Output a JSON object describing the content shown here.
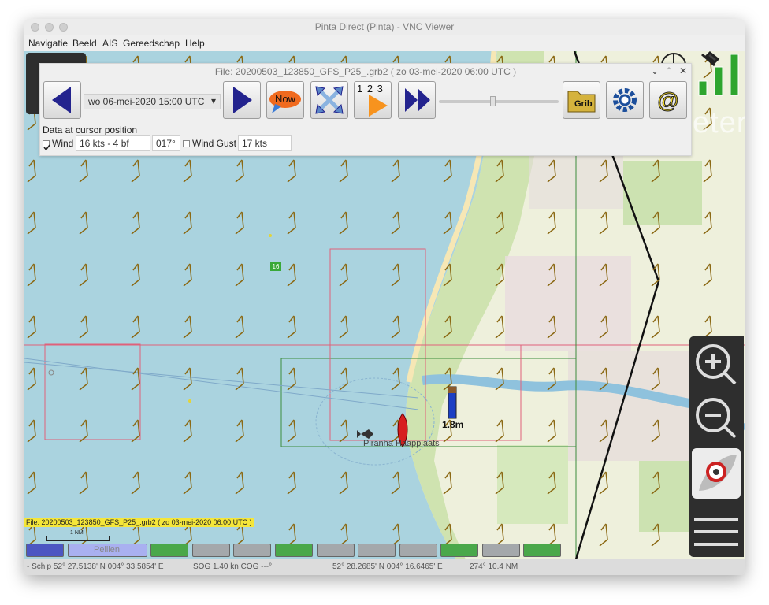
{
  "window": {
    "title": "Pinta Direct (Pinta) - VNC Viewer"
  },
  "menu": {
    "items": [
      "Navigatie",
      "Beeld",
      "AIS",
      "Gereedschap",
      "Help"
    ]
  },
  "grib_dialog": {
    "title": "File: 20200503_123850_GFS_P25_.grb2 ( zo 03-mei-2020 06:00  UTC )",
    "date_value": "wo 06-mei-2020 15:00  UTC",
    "now_label": "Now",
    "numbers_label": "1 2 3",
    "grib_label": "Grib",
    "data_heading": "Data at cursor position",
    "wind_label": "Wind",
    "wind_speed": "16 kts -  4 bf",
    "wind_dir": "017°",
    "gust_label": "Wind Gust",
    "gust_value": "17 kts",
    "wind_checked": true,
    "gust_checked": false,
    "slider_value": 0.45
  },
  "map": {
    "marker_label": "16",
    "tide_height": "1.8m",
    "place_label": "Piranha Haapplaats",
    "scale_label": "1 NM",
    "file_label": "File: 20200503_123850_GFS_P25_.grb2 ( zo 03-mei-2020 06:00  UTC )",
    "layer_label": "Peillen",
    "corner_text": "eter"
  },
  "status": {
    "position": "- Schip 52° 27.5138' N   004° 33.5854' E",
    "speed": "SOG 1.40 kn  COG ---°",
    "cursor": "52° 28.2685' N   004° 16.6465' E",
    "bearing": "274°  10.4 NM"
  },
  "colors": {
    "sea": "#aad3df",
    "land": "#f2efe9",
    "wind_barb": "#8b6914",
    "dialog_bg": "#efefef",
    "accent_blue": "#23238e",
    "filebar": "#f5e63a"
  }
}
